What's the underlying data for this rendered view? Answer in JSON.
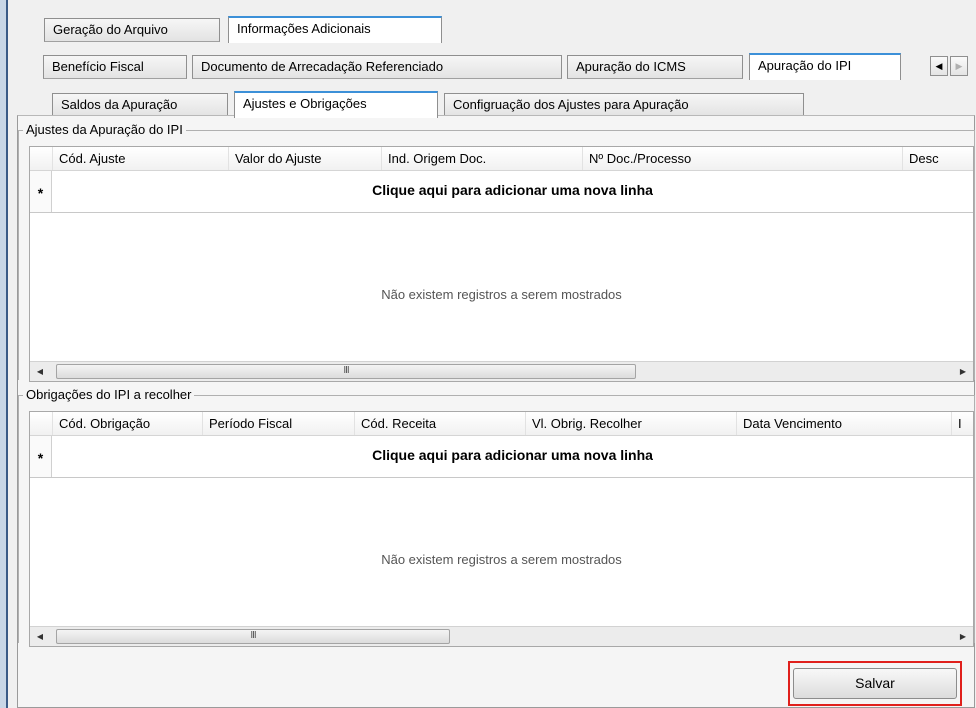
{
  "tabs_level1": [
    {
      "label": "Geração do Arquivo",
      "selected": false
    },
    {
      "label": "Informações Adicionais",
      "selected": true
    }
  ],
  "tabs_level2": [
    {
      "label": "Benefício Fiscal",
      "selected": false
    },
    {
      "label": "Documento de Arrecadação Referenciado",
      "selected": false
    },
    {
      "label": "Apuração do ICMS",
      "selected": false
    },
    {
      "label": "Apuração do IPI",
      "selected": true
    }
  ],
  "tab_nav": {
    "prev": "◀",
    "next": "▶"
  },
  "tabs_level3": [
    {
      "label": "Saldos da Apuração",
      "selected": false
    },
    {
      "label": "Ajustes e Obrigações",
      "selected": true
    },
    {
      "label": "Configruação dos Ajustes para Apuração",
      "selected": false
    }
  ],
  "ajustes": {
    "title": "Ajustes da Apuração do IPI",
    "columns": [
      "Cód. Ajuste",
      "Valor do Ajuste",
      "Ind. Origem Doc.",
      "Nº Doc./Processo",
      "Desc"
    ],
    "new_row_marker": "*",
    "new_row_label": "Clique aqui para adicionar uma nova linha",
    "empty_message": "Não existem registros a serem mostrados",
    "scroll_thumb": "III"
  },
  "obrigacoes": {
    "title": "Obrigações do IPI  a recolher",
    "columns": [
      "Cód. Obrigação",
      "Período Fiscal",
      "Cód. Receita",
      "Vl. Obrig. Recolher",
      "Data Vencimento",
      "I"
    ],
    "new_row_marker": "*",
    "new_row_label": "Clique aqui para adicionar uma nova linha",
    "empty_message": "Não existem registros a serem mostrados",
    "scroll_thumb": "III"
  },
  "save_button": {
    "label": "Salvar",
    "highlight_color": "#e0201c"
  },
  "colors": {
    "selected_tab_accent": "#3c90d8",
    "window_border": "#3a5a86"
  }
}
